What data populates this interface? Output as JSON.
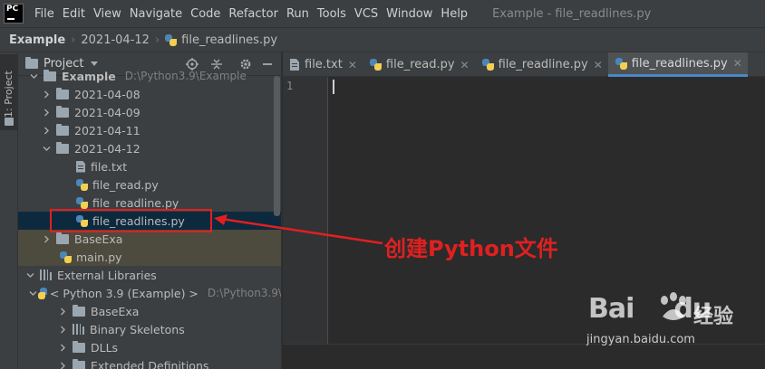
{
  "menubar": {
    "logo_text": "PC",
    "items": [
      "File",
      "Edit",
      "View",
      "Navigate",
      "Code",
      "Refactor",
      "Run",
      "Tools",
      "VCS",
      "Window",
      "Help"
    ],
    "window_title": "Example - file_readlines.py"
  },
  "breadcrumb": {
    "items": [
      "Example",
      "2021-04-12",
      "file_readlines.py"
    ]
  },
  "side_strip": {
    "label": "1: Project"
  },
  "project_panel": {
    "title": "Project",
    "header_icons": [
      "locate-icon",
      "collapse-icon",
      "gear-icon",
      "minimize-icon"
    ],
    "tree": [
      {
        "label": "Example",
        "hint": "D:\\Python3.9\\Example",
        "icon": "folder",
        "depth": 0,
        "expanded": true
      },
      {
        "label": "2021-04-08",
        "icon": "folder",
        "depth": 1,
        "expanded": false
      },
      {
        "label": "2021-04-09",
        "icon": "folder",
        "depth": 1,
        "expanded": false
      },
      {
        "label": "2021-04-11",
        "icon": "folder",
        "depth": 1,
        "expanded": false
      },
      {
        "label": "2021-04-12",
        "icon": "folder",
        "depth": 1,
        "expanded": true
      },
      {
        "label": "file.txt",
        "icon": "text-file",
        "depth": 2
      },
      {
        "label": "file_read.py",
        "icon": "python-file",
        "depth": 2
      },
      {
        "label": "file_readline.py",
        "icon": "python-file",
        "depth": 2
      },
      {
        "label": "file_readlines.py",
        "icon": "python-file",
        "depth": 2,
        "selected": true
      },
      {
        "label": "BaseExa",
        "icon": "folder",
        "depth": 1,
        "expanded": false,
        "highlight": true
      },
      {
        "label": "main.py",
        "icon": "python-file",
        "depth": 1
      },
      {
        "label": "External Libraries",
        "icon": "library",
        "depth": 0,
        "expanded": true
      },
      {
        "label": "< Python 3.9 (Example) >",
        "hint": "D:\\Python3.9\\",
        "icon": "python",
        "depth": 1,
        "expanded": true
      },
      {
        "label": "BaseExa",
        "icon": "folder",
        "depth": 2,
        "expanded": false
      },
      {
        "label": "Binary Skeletons",
        "icon": "library",
        "depth": 2,
        "expanded": false
      },
      {
        "label": "DLLs",
        "icon": "folder",
        "depth": 2,
        "expanded": false
      },
      {
        "label": "Extended Definitions",
        "icon": "folder",
        "depth": 2,
        "expanded": false
      }
    ]
  },
  "editor": {
    "tabs": [
      {
        "label": "file.txt",
        "icon": "text-file",
        "active": false
      },
      {
        "label": "file_read.py",
        "icon": "python-file",
        "active": false
      },
      {
        "label": "file_readline.py",
        "icon": "python-file",
        "active": false
      },
      {
        "label": "file_readlines.py",
        "icon": "python-file",
        "active": true
      }
    ],
    "line_number": "1"
  },
  "annotation": {
    "text": "创建Python文件",
    "color": "#e02020"
  },
  "watermark": {
    "brand": "Bai",
    "brand2": "du",
    "cn": "经验",
    "url": "jingyan.baidu.com"
  },
  "colors": {
    "background": "#2b2b2b",
    "panel": "#3c3f41",
    "selection": "#0d293e",
    "accent": "#4a88c7"
  }
}
